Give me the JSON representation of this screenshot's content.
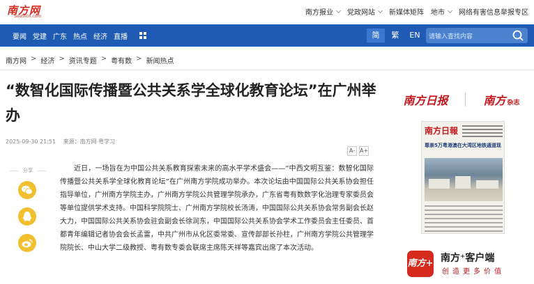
{
  "site": {
    "logo_cn": "南方网",
    "logo_en": "Southcn.com"
  },
  "top_links": [
    {
      "label": "南方报业",
      "dropdown": true
    },
    {
      "label": "党政网站",
      "dropdown": true
    },
    {
      "label": "新媒体矩阵",
      "dropdown": false
    },
    {
      "label": "地市",
      "dropdown": true
    },
    {
      "label": "网络有害信息举报专区",
      "dropdown": false
    }
  ],
  "nav": {
    "items": [
      "要闻",
      "党建",
      "广东",
      "热点",
      "经济",
      "直播"
    ],
    "languages": [
      "简",
      "繁",
      "EN"
    ],
    "active_language": "简",
    "search_placeholder": "请输入查找内容"
  },
  "breadcrumb": [
    "南方网",
    "经济",
    "资讯专题",
    "粤有数",
    "新闻热点"
  ],
  "article": {
    "title": "“数智化国际传播暨公共关系学全球化教育论坛”在广州举办",
    "datetime": "2025-09-30 21:51",
    "source": "来源：南方网·粤学习",
    "font_smaller": "A-",
    "font_larger": "A+",
    "share_label": "分享",
    "body": "近日，一场旨在为中国公共关系教育探索未来的高水平学术盛会——“中西文明互鉴：数智化国际传播暨公共关系学全球化教育论坛”在广州南方学院成功举办。本次论坛由中国国际公共关系协会担任指导单位，广州南方学院主办，广州南方学院公共管理学院承办，广东省粤有数数字化治理专家委员会等单位提供学术支持。中国科学院院士、广州南方学院校长汤涛，中国国际公共关系协会常务副会长赵大力，中国国际公共关系协会驻会副会长徐润东，中国国际公共关系协会学术工作委员会主任委员、首都青年编辑记者协会会长孟雷，中共广州市从化区委常委、宣传部部长孙柱，广州南方学院公共管理学院院长、中山大学二级教授、粤有数专委会联席主席陈天祥等嘉宾出席了本次活动。"
  },
  "share_buttons": [
    "wechat-icon",
    "qq-icon",
    "weibo-icon"
  ],
  "sidebar": {
    "pub1": "南方日报",
    "pub2": "南方",
    "pub2_suffix": "杂志",
    "paper_masthead": "南方日報",
    "paper_headline": "尊崇5万粤港澳在大湾区地铁通道现",
    "app_name": "南方⁺客户端",
    "app_tagline": "创造更多价值",
    "app_icon_text": "南方+"
  },
  "colors": {
    "brand_red": "#d62a1f",
    "nav_blue": "#1f5bb5",
    "share_yellow": "#f2c02e"
  }
}
